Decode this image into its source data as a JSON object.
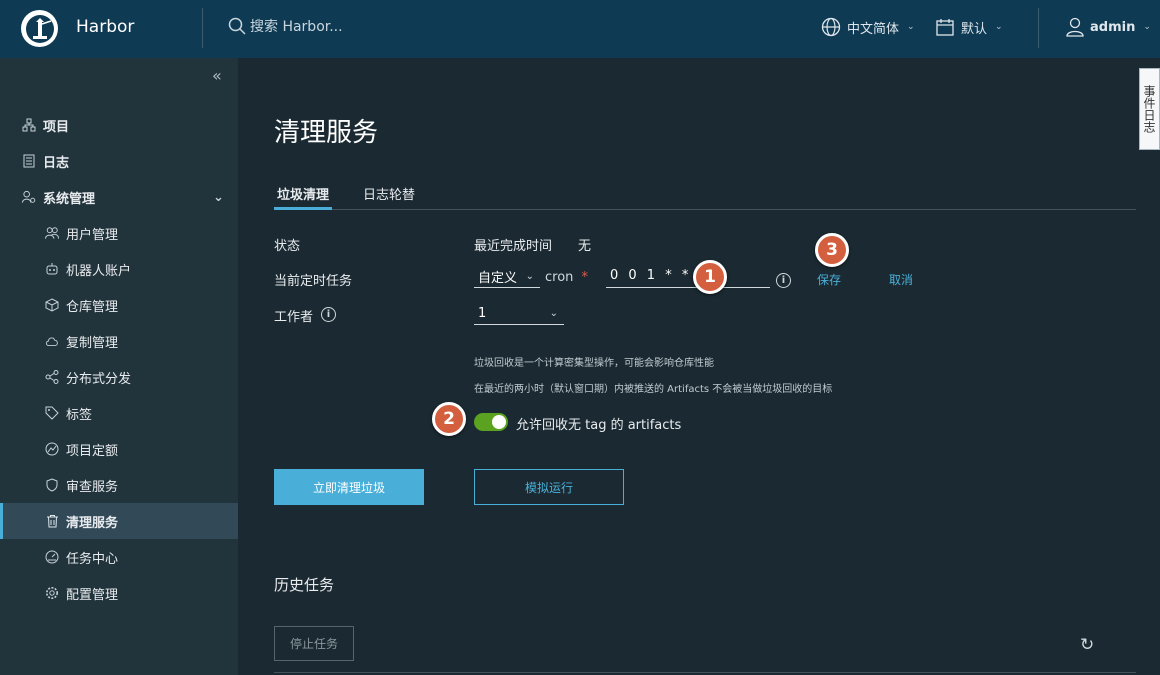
{
  "header": {
    "app_title": "Harbor",
    "search_placeholder": "搜索 Harbor...",
    "language": "中文简体",
    "datetime": "默认",
    "user": "admin"
  },
  "sidebar": {
    "items": [
      {
        "label": "项目",
        "icon": "projects-icon",
        "level": "top"
      },
      {
        "label": "日志",
        "icon": "logs-icon",
        "level": "top"
      },
      {
        "label": "系统管理",
        "icon": "admin-icon",
        "level": "top",
        "expanded": true
      },
      {
        "label": "用户管理",
        "icon": "users-icon",
        "level": "sub"
      },
      {
        "label": "机器人账户",
        "icon": "robot-icon",
        "level": "sub"
      },
      {
        "label": "仓库管理",
        "icon": "registry-icon",
        "level": "sub"
      },
      {
        "label": "复制管理",
        "icon": "replication-icon",
        "level": "sub"
      },
      {
        "label": "分布式分发",
        "icon": "distribution-icon",
        "level": "sub"
      },
      {
        "label": "标签",
        "icon": "tag-icon",
        "level": "sub"
      },
      {
        "label": "项目定额",
        "icon": "quota-icon",
        "level": "sub"
      },
      {
        "label": "审查服务",
        "icon": "shield-icon",
        "level": "sub"
      },
      {
        "label": "清理服务",
        "icon": "trash-icon",
        "level": "sub",
        "active": true
      },
      {
        "label": "任务中心",
        "icon": "gauge-icon",
        "level": "sub"
      },
      {
        "label": "配置管理",
        "icon": "gear-icon",
        "level": "sub"
      }
    ]
  },
  "event_log": "事件日志",
  "page": {
    "title": "清理服务",
    "tabs": [
      "垃圾清理",
      "日志轮替"
    ],
    "status_label": "状态",
    "last_completed_label": "最近完成时间",
    "last_completed_value": "无",
    "schedule_label": "当前定时任务",
    "schedule_type": "自定义",
    "cron_label": "cron",
    "required_mark": "*",
    "cron_value": "0 0 1 * * 6",
    "save": "保存",
    "cancel": "取消",
    "workers_label": "工作者",
    "workers_value": "1",
    "helper_1": "垃圾回收是一个计算密集型操作，可能会影响仓库性能",
    "helper_2": "在最近的两小时（默认窗口期）内被推送的 Artifacts 不会被当做垃圾回收的目标",
    "untagged_toggle_label": "允许回收无 tag 的 artifacts",
    "untagged_toggle_on": true,
    "gc_now": "立即清理垃圾",
    "dry_run": "模拟运行",
    "history_title": "历史任务",
    "stop_job": "停止任务"
  },
  "callouts": [
    "1",
    "2",
    "3"
  ],
  "colors": {
    "header_bg": "#0f3a54",
    "sidebar_bg": "#21333b",
    "main_bg": "#1b2a32",
    "accent": "#49afd9",
    "toggle_on": "#5aa220",
    "callout": "#d35f3f"
  }
}
